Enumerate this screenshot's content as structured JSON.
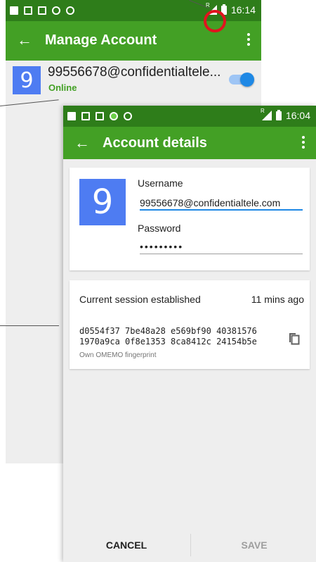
{
  "back_screen": {
    "status_bar": {
      "time": "16:14",
      "roaming_indicator": "R"
    },
    "toolbar": {
      "title": "Manage Account",
      "back_icon": "arrow-left-icon",
      "menu_icon": "more-vert-icon"
    },
    "account": {
      "avatar_letter": "9",
      "jid": "99556678@confidentialtele...",
      "status": "Online",
      "enabled": true
    },
    "highlight_color": "#e0141e"
  },
  "front_screen": {
    "status_bar": {
      "time": "16:04",
      "roaming_indicator": "R"
    },
    "toolbar": {
      "title": "Account details",
      "back_icon": "arrow-left-icon",
      "menu_icon": "more-vert-icon"
    },
    "login": {
      "avatar_letter": "9",
      "username_label": "Username",
      "username_value": "99556678@confidentialtele.com",
      "password_label": "Password",
      "password_value": "•••••••••"
    },
    "session": {
      "label": "Current session established",
      "time_ago": "11 mins ago",
      "fingerprint_line1": "d0554f37 7be48a28 e569bf90 40381576",
      "fingerprint_line2": "1970a9ca 0f8e1353 8ca8412c 24154b5e",
      "fingerprint_caption": "Own OMEMO fingerprint",
      "copy_icon": "copy-icon"
    },
    "actions": {
      "cancel": "CANCEL",
      "save": "SAVE"
    }
  },
  "colors": {
    "status_bar": "#2e7d1a",
    "toolbar": "#43a025",
    "accent": "#1e88e5",
    "avatar": "#4e7cf2",
    "online": "#43a025",
    "disabled_text": "#9e9e9e"
  }
}
